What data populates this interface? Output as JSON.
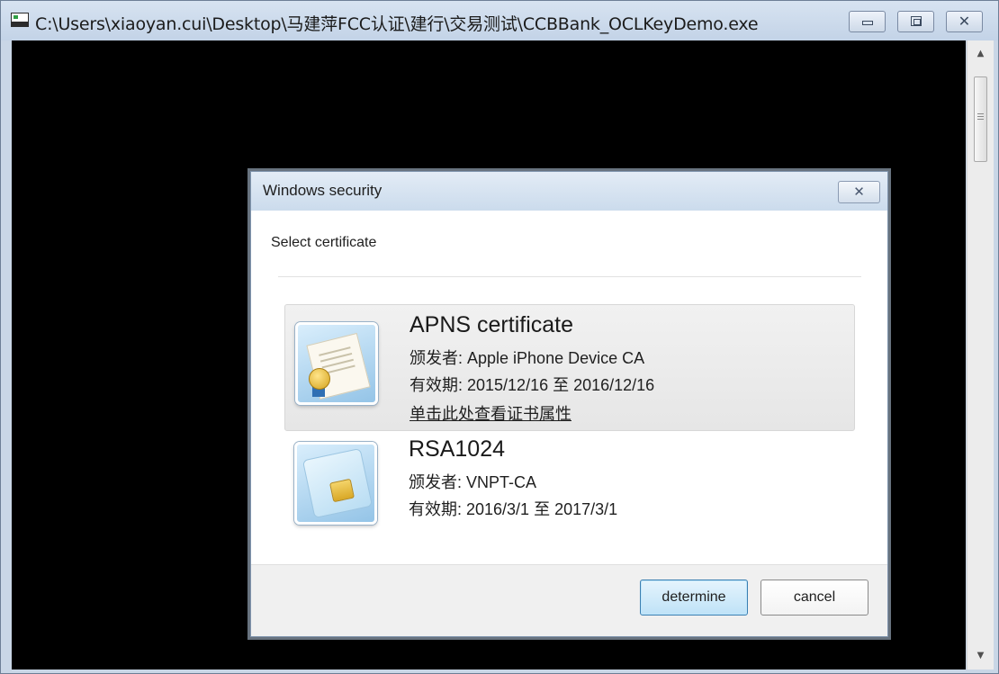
{
  "window": {
    "title": "C:\\Users\\xiaoyan.cui\\Desktop\\马建萍FCC认证\\建行\\交易测试\\CCBBank_OCLKeyDemo.exe",
    "minimize_icon": "minimize-icon",
    "maximize_icon": "maximize-icon",
    "close_glyph": "✕"
  },
  "dialog": {
    "title": "Windows security",
    "close_glyph": "✕",
    "subtitle": "Select certificate",
    "certificates": [
      {
        "name": "APNS certificate",
        "issuer": "颁发者: Apple iPhone Device CA",
        "validity": "有效期: 2015/12/16 至 2016/12/16",
        "properties_link": "单击此处查看证书属性",
        "icon": "certificate-seal-icon",
        "selected": true
      },
      {
        "name": "RSA1024",
        "issuer": "颁发者: VNPT-CA",
        "validity": "有效期: 2016/3/1 至 2017/3/1",
        "icon": "smart-card-icon",
        "selected": false
      }
    ],
    "ok_label": "determine",
    "cancel_label": "cancel"
  },
  "scrollbar": {
    "up_glyph": "▲",
    "down_glyph": "▼"
  },
  "colors": {
    "console_background": "#000000",
    "selected_row": "#ebebeb",
    "default_button_border": "#3c7fb1"
  }
}
